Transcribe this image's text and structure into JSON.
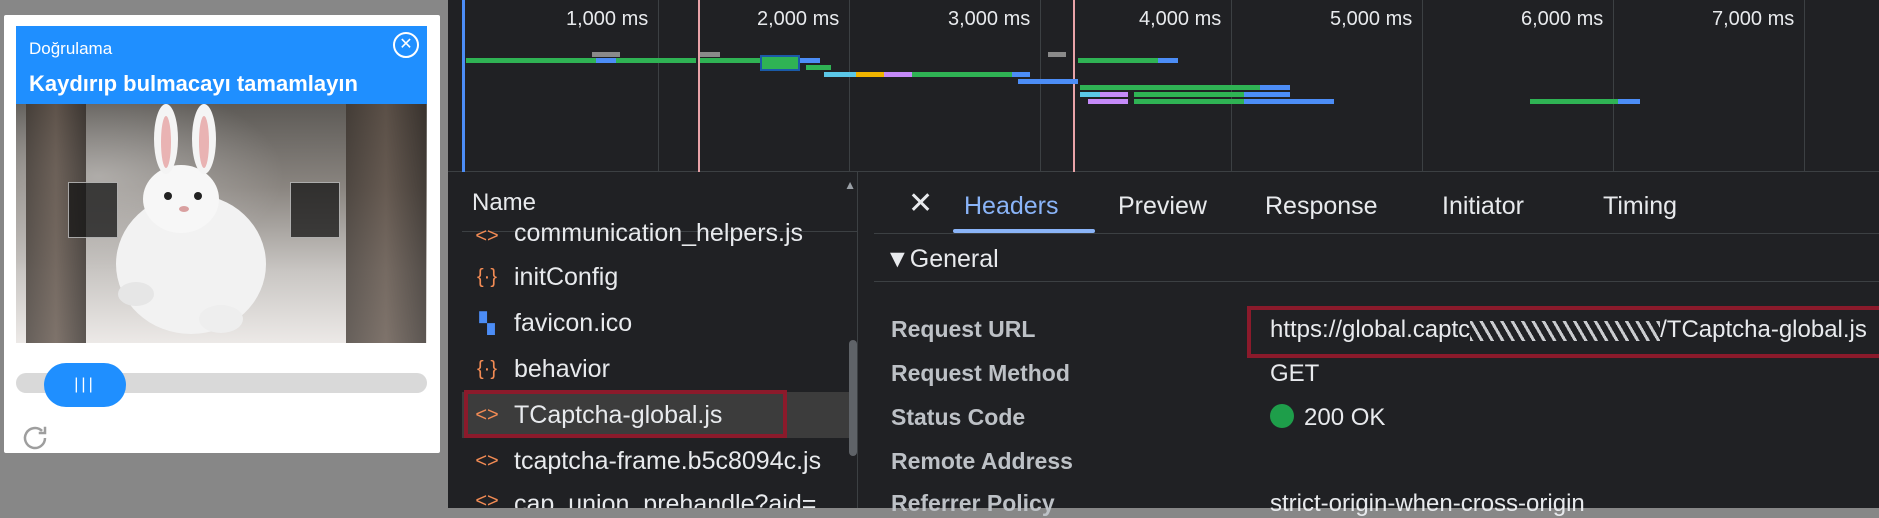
{
  "captcha": {
    "label": "Doğrulama",
    "title": "Kaydırıp bulmacayı tamamlayın",
    "close_icon": "close-icon",
    "slider_handle_text": "|||",
    "refresh_icon": "refresh-icon"
  },
  "timeline": {
    "ticks": [
      "1,000 ms",
      "2,000 ms",
      "3,000 ms",
      "4,000 ms",
      "5,000 ms",
      "6,000 ms",
      "7,000 ms"
    ]
  },
  "name_panel": {
    "header": "Name",
    "rows": [
      {
        "label": "communication_helpers.js",
        "icon": "script-icon"
      },
      {
        "label": "initConfig",
        "icon": "fetch-icon"
      },
      {
        "label": "favicon.ico",
        "icon": "image-icon"
      },
      {
        "label": "behavior",
        "icon": "fetch-icon"
      },
      {
        "label": "TCaptcha-global.js",
        "icon": "script-icon"
      },
      {
        "label": "tcaptcha-frame.b5c8094c.js",
        "icon": "script-icon"
      },
      {
        "label": "cap_union_prehandle?aid=",
        "icon": "script-icon"
      }
    ]
  },
  "details": {
    "tabs": [
      "Headers",
      "Preview",
      "Response",
      "Initiator",
      "Timing"
    ],
    "active_tab": "Headers",
    "section": "General",
    "headers": [
      {
        "key": "Request URL",
        "value_prefix": "https://global.captc",
        "value_suffix": "/TCaptcha-global.js"
      },
      {
        "key": "Request Method",
        "value": "GET"
      },
      {
        "key": "Status Code",
        "value": "200 OK"
      },
      {
        "key": "Remote Address",
        "value": ""
      },
      {
        "key": "Referrer Policy",
        "value": "strict-origin-when-cross-origin"
      }
    ],
    "status_color": "#1e9e4a"
  }
}
